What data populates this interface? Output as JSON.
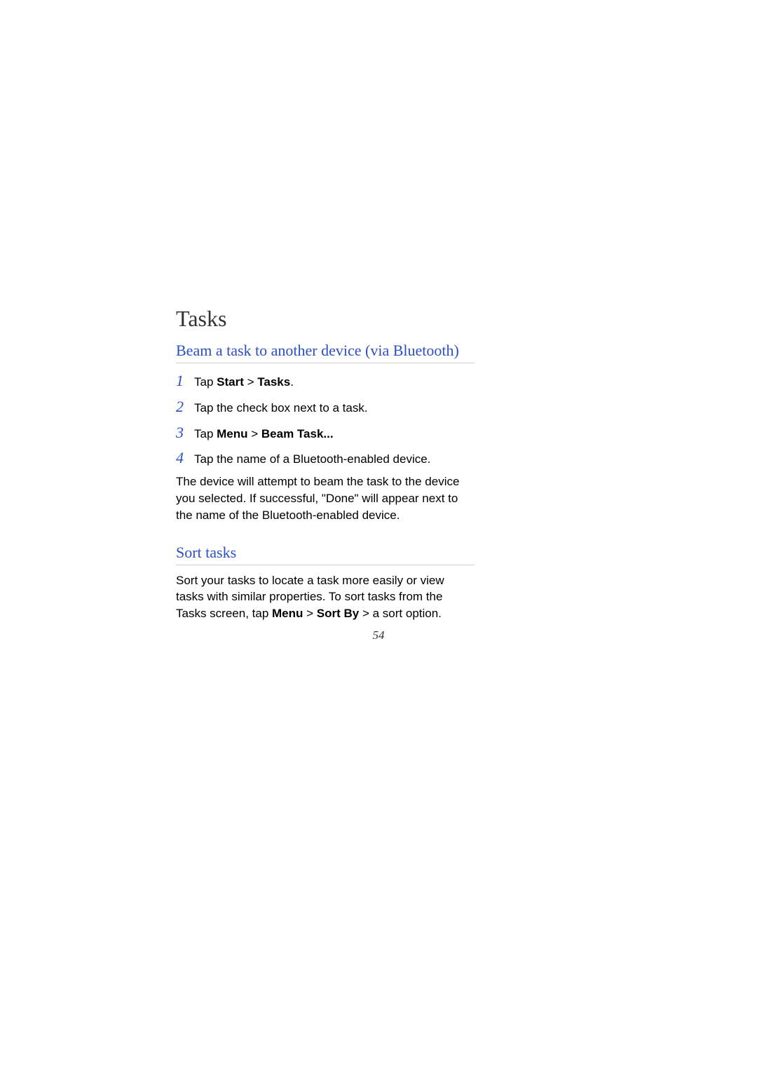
{
  "title": "Tasks",
  "section1": {
    "heading": "Beam a task to another device (via Bluetooth)",
    "steps": [
      {
        "num": "1",
        "pre": "Tap ",
        "bold": "Start",
        "mid": " > ",
        "bold2": "Tasks",
        "post": "."
      },
      {
        "num": "2",
        "pre": "Tap the check box next to a task.",
        "bold": "",
        "mid": "",
        "bold2": "",
        "post": ""
      },
      {
        "num": "3",
        "pre": "Tap ",
        "bold": "Menu",
        "mid": " > ",
        "bold2": "Beam Task...",
        "post": ""
      },
      {
        "num": "4",
        "pre": "Tap the name of a Bluetooth-enabled device.",
        "bold": "",
        "mid": "",
        "bold2": "",
        "post": ""
      }
    ],
    "after": "The device will attempt to beam the task to the device you selected. If successful, \"Done\" will appear next to the name of the Bluetooth-enabled device."
  },
  "section2": {
    "heading": "Sort tasks",
    "para_pre": "Sort your tasks to locate a task more easily or view tasks with similar properties. To sort tasks from the Tasks screen, tap ",
    "bold1": "Menu",
    "mid": " > ",
    "bold2": "Sort By",
    "post": " > a sort option."
  },
  "page_number": "54"
}
